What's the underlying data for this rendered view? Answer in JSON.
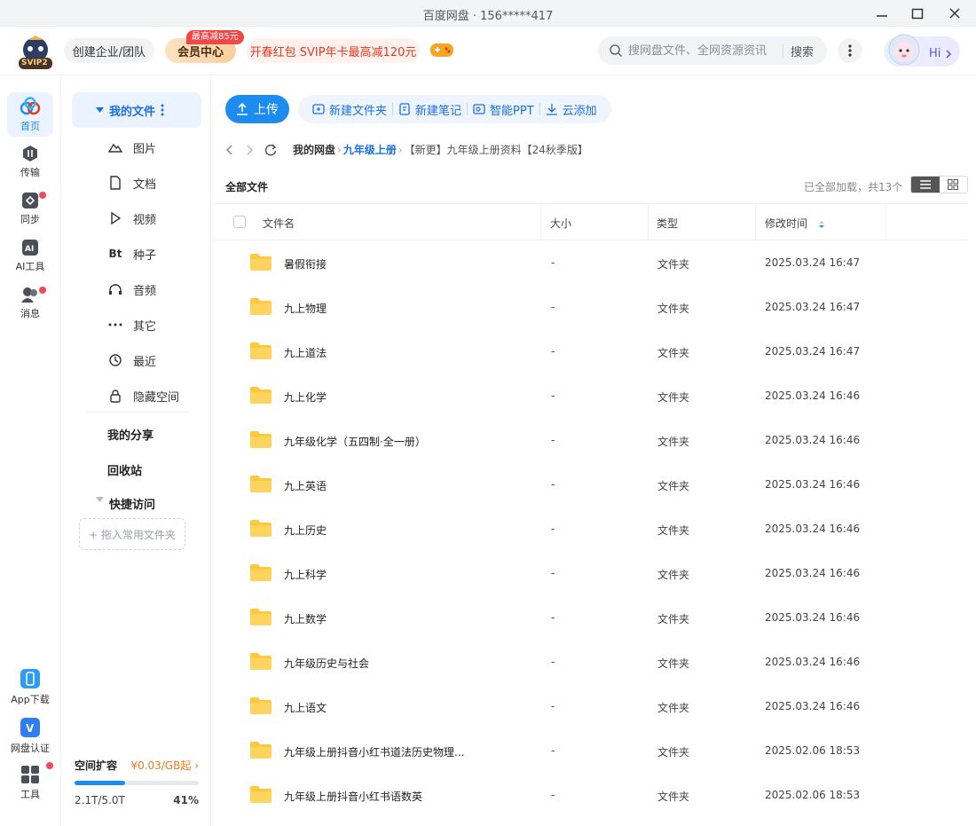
{
  "window": {
    "title": "百度网盘 · 156*****417"
  },
  "header": {
    "svip_label": "SVIP2",
    "team_label": "创建企业/团队",
    "vip_label": "会员中心",
    "vip_badge": "最高减85元",
    "promo_label": "开春红包 SVIP年卡最高减120元",
    "search_placeholder": "搜网盘文件、全网资源资讯",
    "search_button": "搜索",
    "greeting": "Hi"
  },
  "rail": [
    {
      "label": "首页",
      "icon": "home-icon"
    },
    {
      "label": "传输",
      "icon": "transfer-icon"
    },
    {
      "label": "同步",
      "icon": "sync-icon"
    },
    {
      "label": "AI工具",
      "icon": "ai-tools-icon"
    },
    {
      "label": "消息",
      "icon": "message-icon"
    },
    {
      "label": "App下载",
      "icon": "phone-icon"
    },
    {
      "label": "网盘认证",
      "icon": "verify-icon"
    },
    {
      "label": "工具",
      "icon": "tools-icon"
    }
  ],
  "sidebar": {
    "my_files": "我的文件",
    "sub_items": [
      "图片",
      "文档",
      "视频",
      "种子",
      "音频",
      "其它",
      "最近",
      "隐藏空间"
    ],
    "torrent_glyph": "Bt",
    "my_share": "我的分享",
    "recycle": "回收站",
    "quick_access": "快捷访问",
    "drop_hint": "+ 拖入常用文件夹",
    "space": {
      "title": "空间扩容",
      "price": "¥0.03/GB起",
      "usage": "2.1T/5.0T",
      "percent": "41%",
      "fill": 0.41
    }
  },
  "toolbar": {
    "upload": "上传",
    "actions": [
      "新建文件夹",
      "新建笔记",
      "智能PPT",
      "云添加"
    ]
  },
  "breadcrumb": {
    "root": "我的网盘",
    "level1": "九年级上册",
    "current": "【新更】九年级上册资料【24秋季版】"
  },
  "list_header": {
    "all_files": "全部文件",
    "loaded": "已全部加载，共13个"
  },
  "table": {
    "columns": [
      "文件名",
      "大小",
      "类型",
      "修改时间"
    ],
    "rows": [
      {
        "name": "暑假衔接",
        "size": "-",
        "type": "文件夹",
        "time": "2025.03.24 16:47"
      },
      {
        "name": "九上物理",
        "size": "-",
        "type": "文件夹",
        "time": "2025.03.24 16:47"
      },
      {
        "name": "九上道法",
        "size": "-",
        "type": "文件夹",
        "time": "2025.03.24 16:47"
      },
      {
        "name": "九上化学",
        "size": "-",
        "type": "文件夹",
        "time": "2025.03.24 16:46"
      },
      {
        "name": "九年级化学（五四制·全一册）",
        "size": "-",
        "type": "文件夹",
        "time": "2025.03.24 16:46"
      },
      {
        "name": "九上英语",
        "size": "-",
        "type": "文件夹",
        "time": "2025.03.24 16:46"
      },
      {
        "name": "九上历史",
        "size": "-",
        "type": "文件夹",
        "time": "2025.03.24 16:46"
      },
      {
        "name": "九上科学",
        "size": "-",
        "type": "文件夹",
        "time": "2025.03.24 16:46"
      },
      {
        "name": "九上数学",
        "size": "-",
        "type": "文件夹",
        "time": "2025.03.24 16:46"
      },
      {
        "name": "九年级历史与社会",
        "size": "-",
        "type": "文件夹",
        "time": "2025.03.24 16:46"
      },
      {
        "name": "九上语文",
        "size": "-",
        "type": "文件夹",
        "time": "2025.03.24 16:46"
      },
      {
        "name": "九年级上册抖音小红书道法历史物理...",
        "size": "-",
        "type": "文件夹",
        "time": "2025.02.06 18:53"
      },
      {
        "name": "九年级上册抖音小红书语数英",
        "size": "-",
        "type": "文件夹",
        "time": "2025.02.06 18:53"
      }
    ]
  },
  "colors": {
    "accent": "#1c8cf0",
    "folder": "#ffc83d",
    "badge": "#f04848",
    "promo_text": "#e8391d",
    "price": "#e8781d"
  }
}
